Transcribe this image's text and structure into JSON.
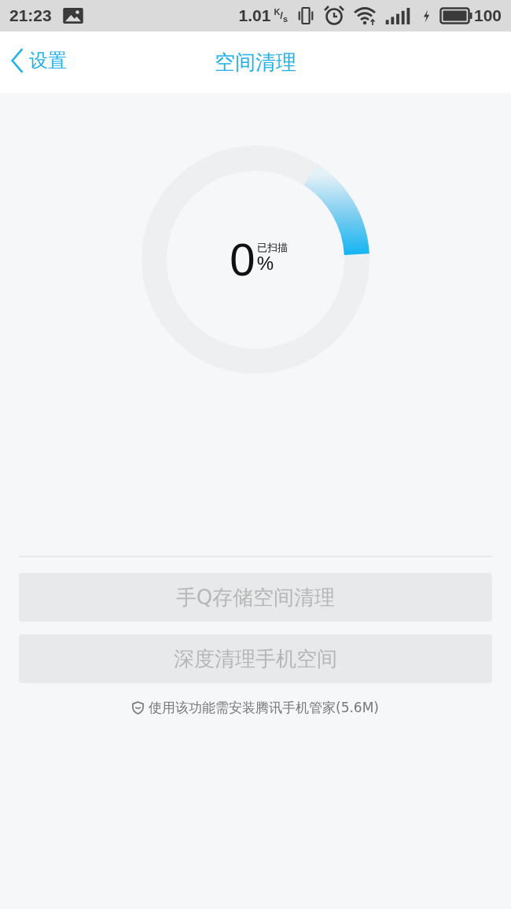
{
  "status_bar": {
    "time": "21:23",
    "speed": "1.01",
    "speed_unit": "$^{K}$/$_{s}$",
    "charging": true,
    "battery": "100"
  },
  "nav": {
    "back_label": "设置",
    "title": "空间清理"
  },
  "scan": {
    "value": "0",
    "caption": "已扫描",
    "unit": "%"
  },
  "buttons": [
    {
      "label": "手Q存储空间清理",
      "disabled": true
    },
    {
      "label": "深度清理手机空间",
      "disabled": true
    }
  ],
  "note": {
    "text": "使用该功能需安装腾讯手机管家(5.6M)"
  }
}
